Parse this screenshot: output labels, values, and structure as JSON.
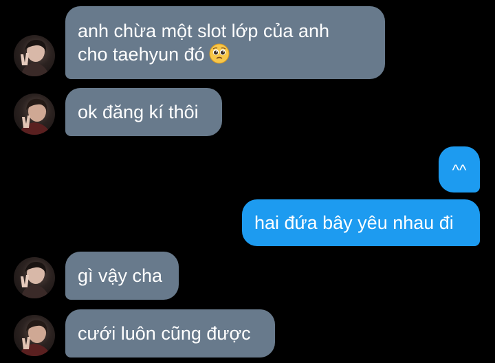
{
  "messages": [
    {
      "sender": "them",
      "line1": "anh chừa một slot lớp của anh",
      "line2": "cho taehyun đó",
      "emoji": "pleading-face-icon"
    },
    {
      "sender": "them",
      "text": "ok đăng kí thôi"
    },
    {
      "sender": "me",
      "text": "^^"
    },
    {
      "sender": "me",
      "text": "hai đứa bây yêu nhau đi"
    },
    {
      "sender": "them",
      "text": "gì vậy cha"
    },
    {
      "sender": "them",
      "text": "cưới luôn cũng được"
    }
  ],
  "colors": {
    "background": "#000000",
    "incoming_bubble": "#687a8c",
    "outgoing_bubble": "#1d9bf0",
    "text": "#ffffff"
  }
}
